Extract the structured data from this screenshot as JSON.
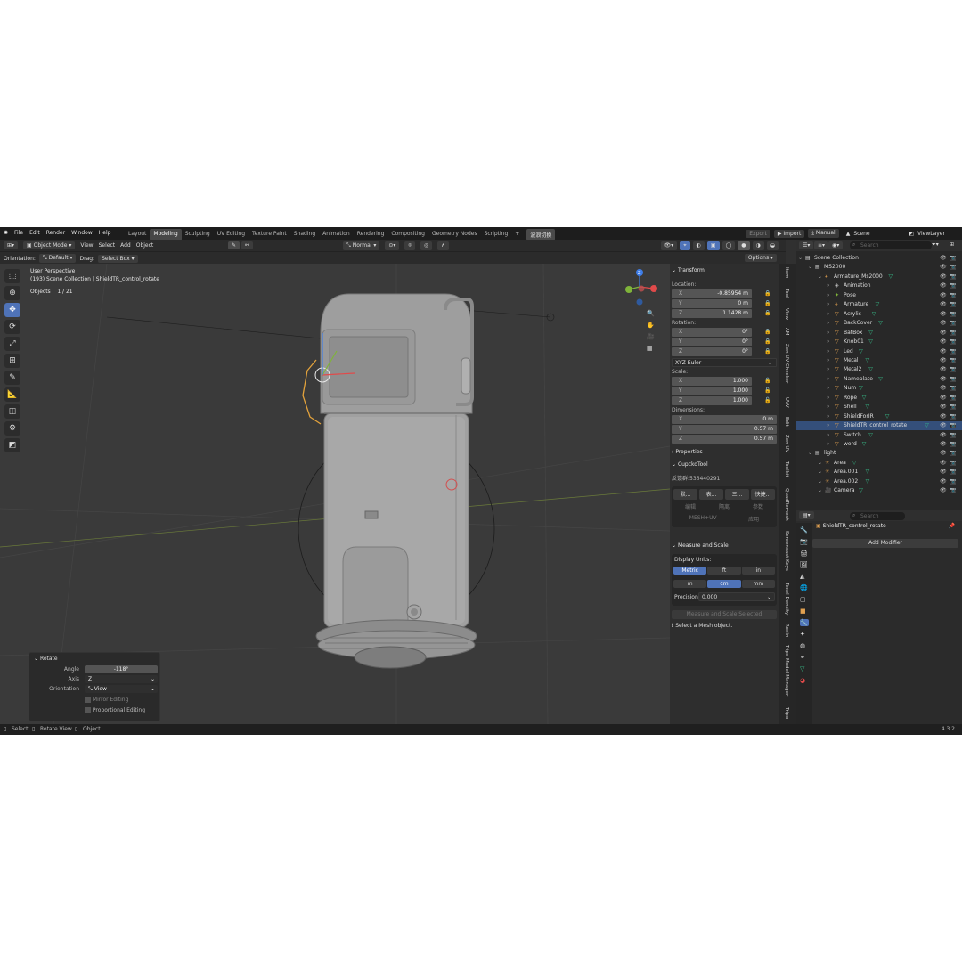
{
  "topbar": {
    "menu": [
      "File",
      "Edit",
      "Render",
      "Window",
      "Help"
    ],
    "workspaces": [
      "Layout",
      "Modeling",
      "Sculpting",
      "UV Editing",
      "Texture Paint",
      "Shading",
      "Animation",
      "Rendering",
      "Compositing",
      "Geometry Nodes",
      "Scripting"
    ],
    "active_workspace": "Modeling",
    "extra_tab": "波浪切换",
    "export_label": "Export",
    "import_label": "Import",
    "manual_label": "Manual",
    "scene_label": "Scene",
    "viewlayer_label": "ViewLayer"
  },
  "viewport_header": {
    "mode": "Object Mode",
    "menus": [
      "View",
      "Select",
      "Add",
      "Object"
    ],
    "transform_orientation": "Normal",
    "orientation_label": "Orientation:",
    "orientation_value": "Default",
    "drag_label": "Drag:",
    "drag_value": "Select Box",
    "options_label": "Options"
  },
  "viewport": {
    "line1": "User Perspective",
    "line2": "(193) Scene Collection | ShieldTR_control_rotate",
    "objects_label": "Objects",
    "objects_count": "1 / 21",
    "axis_x": "X",
    "axis_y": "Y",
    "axis_z": "Z"
  },
  "rotate_panel": {
    "title": "Rotate",
    "angle_label": "Angle",
    "angle_value": "-118°",
    "axis_label": "Axis",
    "axis_value": "Z",
    "orientation_label": "Orientation",
    "orientation_value": "View",
    "mirror_label": "Mirror Editing",
    "proportional_label": "Proportional Editing"
  },
  "npanel": {
    "transform_title": "Transform",
    "location_label": "Location:",
    "location": [
      "-0.85954 m",
      "0 m",
      "1.1428 m"
    ],
    "rotation_label": "Rotation:",
    "rotation": [
      "0°",
      "0°",
      "0°"
    ],
    "rotation_mode": "XYZ Euler",
    "scale_label": "Scale:",
    "scale": [
      "1.000",
      "1.000",
      "1.000"
    ],
    "dimensions_label": "Dimensions:",
    "dimensions": [
      "0 m",
      "0.57 m",
      "0.57 m"
    ],
    "properties_title": "Properties",
    "cupcko_title": "CupckoTool",
    "cupcko_id": "反馈群:536440291",
    "cupcko_buttons": [
      "默...",
      "表...",
      "三...",
      "快捷..."
    ],
    "cupcko_row2": [
      "编辑",
      "隔离",
      "参数"
    ],
    "cupcko_row3": [
      "MESH+UV",
      "应用"
    ],
    "measure_title": "Measure and Scale",
    "display_units_label": "Display Units:",
    "units_row1": [
      "Metric",
      "ft",
      "in"
    ],
    "units_row2": [
      "m",
      "cm",
      "mm"
    ],
    "precision_label": "Precision:",
    "precision_value": "0.000",
    "measure_button": "Measure and Scale Selected",
    "select_mesh_msg": "Select a Mesh object."
  },
  "vertical_tabs": [
    "Item",
    "Tool",
    "View",
    "AM",
    "Zen UV Checker",
    "UVV",
    "Edit",
    "Zen UV",
    "Toolkit",
    "QuadRemesh",
    "Screencast Keys",
    "Texel Density",
    "Rodin",
    "Tripo Model Manager",
    "Tripo"
  ],
  "outliner": {
    "search_placeholder": "Search",
    "items": [
      {
        "name": "Scene Collection",
        "depth": 0,
        "icon": "collection"
      },
      {
        "name": "MS2000",
        "depth": 1,
        "icon": "collection"
      },
      {
        "name": "Armature_Ms2000",
        "depth": 2,
        "icon": "armature"
      },
      {
        "name": "Animation",
        "depth": 3,
        "icon": "action"
      },
      {
        "name": "Pose",
        "depth": 3,
        "icon": "pose"
      },
      {
        "name": "Armature",
        "depth": 3,
        "icon": "armature"
      },
      {
        "name": "Acrylic",
        "depth": 3,
        "icon": "mesh"
      },
      {
        "name": "BackCover",
        "depth": 3,
        "icon": "mesh"
      },
      {
        "name": "BatBox",
        "depth": 3,
        "icon": "mesh"
      },
      {
        "name": "Knob01",
        "depth": 3,
        "icon": "mesh"
      },
      {
        "name": "Led",
        "depth": 3,
        "icon": "mesh"
      },
      {
        "name": "Metal",
        "depth": 3,
        "icon": "mesh"
      },
      {
        "name": "Metal2",
        "depth": 3,
        "icon": "mesh"
      },
      {
        "name": "Nameplate",
        "depth": 3,
        "icon": "mesh"
      },
      {
        "name": "Num",
        "depth": 3,
        "icon": "mesh"
      },
      {
        "name": "Rope",
        "depth": 3,
        "icon": "mesh"
      },
      {
        "name": "Shell",
        "depth": 3,
        "icon": "mesh"
      },
      {
        "name": "ShieldForIR",
        "depth": 3,
        "icon": "mesh"
      },
      {
        "name": "ShieldTR_control_rotate",
        "depth": 3,
        "icon": "mesh",
        "selected": true
      },
      {
        "name": "Switch",
        "depth": 3,
        "icon": "mesh"
      },
      {
        "name": "word",
        "depth": 3,
        "icon": "mesh"
      },
      {
        "name": "light",
        "depth": 1,
        "icon": "collection"
      },
      {
        "name": "Area",
        "depth": 2,
        "icon": "light"
      },
      {
        "name": "Area.001",
        "depth": 2,
        "icon": "light"
      },
      {
        "name": "Area.002",
        "depth": 2,
        "icon": "light"
      },
      {
        "name": "Camera",
        "depth": 2,
        "icon": "camera"
      }
    ]
  },
  "properties": {
    "search_placeholder": "Search",
    "object_name": "ShieldTR_control_rotate",
    "add_modifier_label": "Add Modifier"
  },
  "statusbar": {
    "select": "Select",
    "rotate_view": "Rotate View",
    "object": "Object",
    "version": "4.3.2"
  },
  "colors": {
    "accent": "#4f73b8",
    "selection": "#344f7a",
    "mesh_icon": "#e0a050",
    "data_icon": "#37c28d",
    "x_axis": "#e14a4a",
    "y_axis": "#7fb43a",
    "z_axis": "#3e7de8"
  }
}
